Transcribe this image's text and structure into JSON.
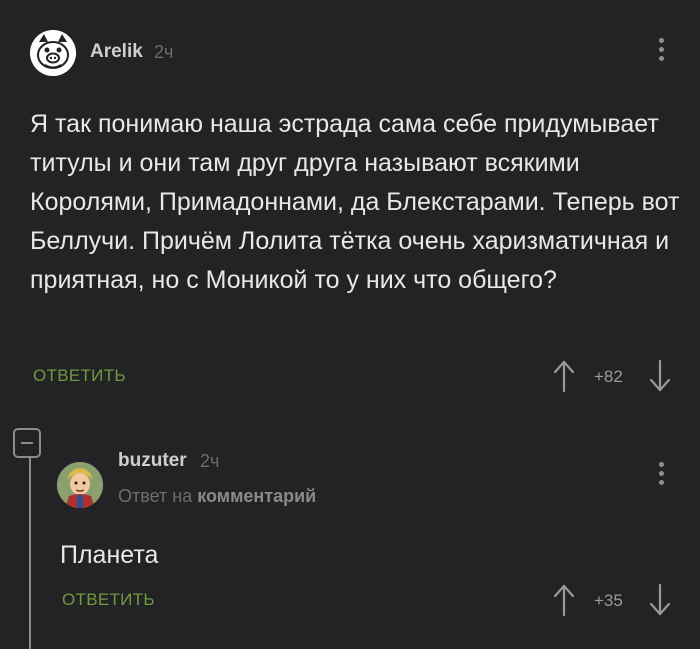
{
  "comments": [
    {
      "author": "Arelik",
      "time": "2ч",
      "text": "Я так понимаю наша эстрада сама себе придумывает титулы и они там друг друга называют всякими Королями, Примадоннами, да Блекстарами. Теперь вот Беллучи. Причём Лолита тётка очень харизматичная и приятная, но с Моникой то у них что общего?",
      "reply_label": "ОТВЕТИТЬ",
      "score": "+82",
      "avatar_icon": "pig-face-avatar"
    },
    {
      "author": "buzuter",
      "time": "2ч",
      "reply_to_prefix": "Ответ на",
      "reply_to_target": "комментарий",
      "text": "Планета",
      "reply_label": "ОТВЕТИТЬ",
      "score": "+35",
      "avatar_icon": "cartoon-character-avatar"
    }
  ],
  "colors": {
    "background": "#232325",
    "accent_green": "#6f9a3f",
    "muted": "#6d6d6d"
  }
}
